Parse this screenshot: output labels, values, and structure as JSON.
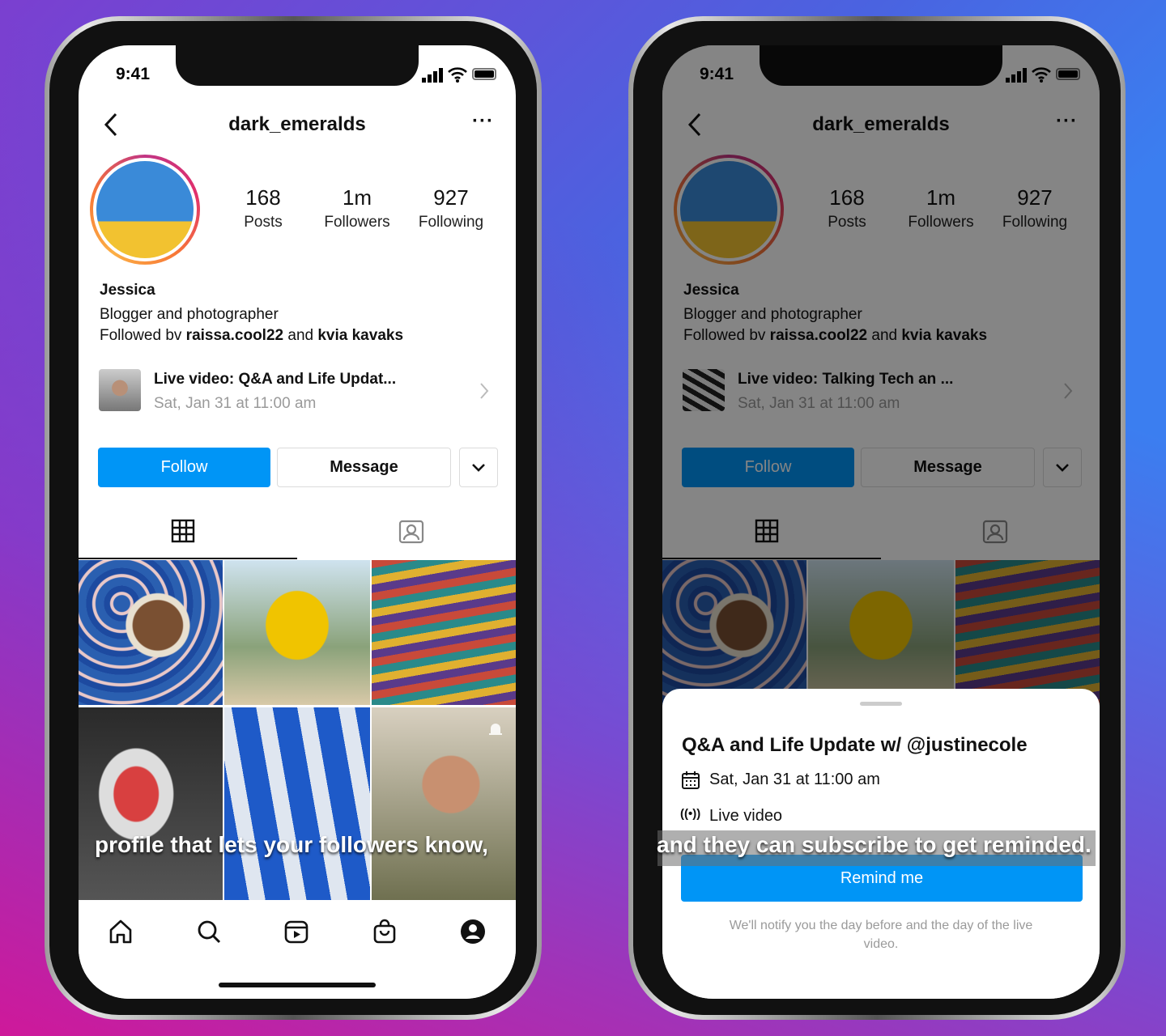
{
  "status": {
    "time": "9:41"
  },
  "profile": {
    "username": "dark_emeralds",
    "stats": [
      {
        "value": "168",
        "label": "Posts"
      },
      {
        "value": "1m",
        "label": "Followers"
      },
      {
        "value": "927",
        "label": "Following"
      }
    ],
    "name": "Jessica",
    "bio": "Blogger and photographer",
    "followed_prefix": "Followed bv ",
    "followed_user1": "raissa.cool22",
    "followed_and": " and ",
    "followed_user2": "kvia  kavaks",
    "follow_label": "Follow",
    "message_label": "Message"
  },
  "left": {
    "live_title": "Live video: Q&A and Life Updat...",
    "live_date": "Sat, Jan 31 at 11:00 am",
    "caption": "profile that lets your followers know,"
  },
  "right": {
    "live_title": "Live video: Talking Tech an ...",
    "live_date": "Sat, Jan 31 at 11:00 am",
    "caption": "and they can subscribe to get reminded."
  },
  "sheet": {
    "title": "Q&A and Life Update w/ @justinecole",
    "date": "Sat, Jan 31 at 11:00 am",
    "type": "Live video",
    "button": "Remind me",
    "note": "We'll notify you the day before and the day of the live video."
  },
  "colors": {
    "accent": "#0095f6",
    "text": "#111111",
    "muted": "#9a9a9a"
  },
  "nav_icons": [
    "home-icon",
    "search-icon",
    "reels-icon",
    "shop-icon",
    "profile-icon"
  ]
}
